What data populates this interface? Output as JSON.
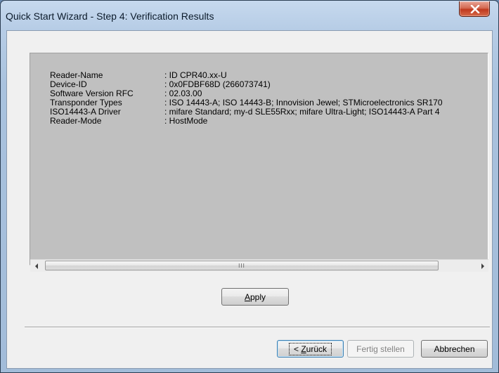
{
  "window": {
    "title": "Quick Start Wizard - Step 4: Verification Results"
  },
  "results": [
    {
      "label": "Reader-Name",
      "value": ": ID CPR40.xx-U"
    },
    {
      "label": "Device-ID",
      "value": ": 0x0FDBF68D (266073741)"
    },
    {
      "label": "Software Version RFC",
      "value": ": 02.03.00"
    },
    {
      "label": "Transponder Types",
      "value": ": ISO 14443-A; ISO 14443-B; Innovision Jewel; STMicroelectronics SR170"
    },
    {
      "label": "ISO14443-A Driver",
      "value": ": mifare Standard; my-d SLE55Rxx; mifare Ultra-Light; ISO14443-A Part 4"
    },
    {
      "label": "Reader-Mode",
      "value": ": HostMode"
    }
  ],
  "scrollbar": {
    "grip": "III"
  },
  "buttons": {
    "apply": {
      "prefix": "",
      "accel": "A",
      "rest": "pply"
    },
    "back": {
      "prefix": "< ",
      "accel": "Z",
      "rest": "urück"
    },
    "finish": {
      "label": "Fertig stellen"
    },
    "cancel": {
      "label": "Abbrechen"
    }
  },
  "colors": {
    "panel_bg": "#c0c0c0",
    "dialog_bg": "#f0f0f0",
    "close_red": "#c0391e"
  }
}
